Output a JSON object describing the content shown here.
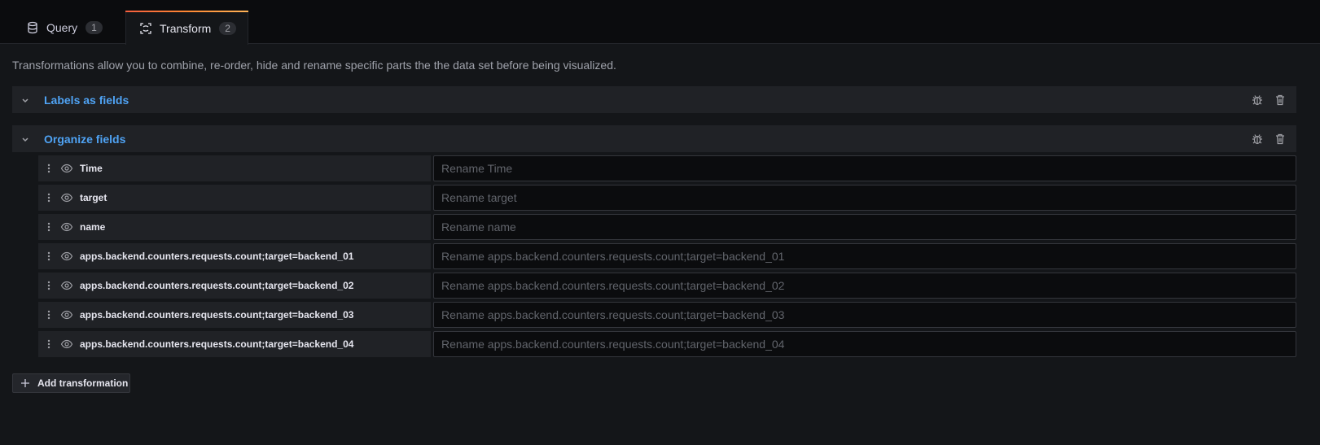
{
  "tabs": [
    {
      "label": "Query",
      "count": "1",
      "icon": "database-icon"
    },
    {
      "label": "Transform",
      "count": "2",
      "icon": "transform-icon"
    }
  ],
  "description": "Transformations allow you to combine, re-order, hide and rename specific parts the the data set before being visualized.",
  "transformations": [
    {
      "title": "Labels as fields"
    },
    {
      "title": "Organize fields"
    }
  ],
  "fields": [
    {
      "name": "Time",
      "placeholder": "Rename Time"
    },
    {
      "name": "target",
      "placeholder": "Rename target"
    },
    {
      "name": "name",
      "placeholder": "Rename name"
    },
    {
      "name": "apps.backend.counters.requests.count;target=backend_01",
      "placeholder": "Rename apps.backend.counters.requests.count;target=backend_01"
    },
    {
      "name": "apps.backend.counters.requests.count;target=backend_02",
      "placeholder": "Rename apps.backend.counters.requests.count;target=backend_02"
    },
    {
      "name": "apps.backend.counters.requests.count;target=backend_03",
      "placeholder": "Rename apps.backend.counters.requests.count;target=backend_03"
    },
    {
      "name": "apps.backend.counters.requests.count;target=backend_04",
      "placeholder": "Rename apps.backend.counters.requests.count;target=backend_04"
    }
  ],
  "add_button": {
    "label": "Add transformation"
  },
  "colors": {
    "accent_link": "#4fa3f4",
    "tab_active_gradient": [
      "#f55f3e",
      "#ffb357"
    ],
    "background": "#141619",
    "panel": "#202226"
  }
}
